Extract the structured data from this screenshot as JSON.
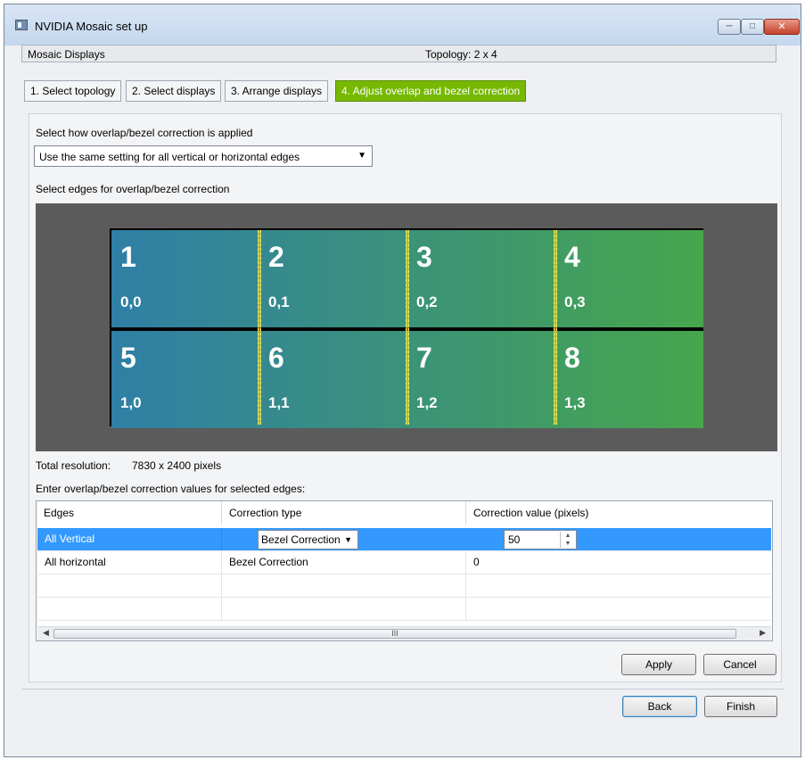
{
  "window": {
    "title": "NVIDIA Mosaic set up"
  },
  "header": {
    "left": "Mosaic Displays",
    "right": "Topology: 2 x 4"
  },
  "tabs": [
    {
      "label": "1. Select topology"
    },
    {
      "label": "2. Select displays"
    },
    {
      "label": "3. Arrange displays"
    },
    {
      "label": "4. Adjust overlap and bezel correction",
      "active": true
    }
  ],
  "apply_mode": {
    "label": "Select how overlap/bezel correction is applied",
    "selected": "Use the same setting for all vertical or horizontal edges"
  },
  "edges_label": "Select edges for overlap/bezel correction",
  "displays": [
    {
      "num": "1",
      "coord": "0,0"
    },
    {
      "num": "2",
      "coord": "0,1"
    },
    {
      "num": "3",
      "coord": "0,2"
    },
    {
      "num": "4",
      "coord": "0,3"
    },
    {
      "num": "5",
      "coord": "1,0"
    },
    {
      "num": "6",
      "coord": "1,1"
    },
    {
      "num": "7",
      "coord": "1,2"
    },
    {
      "num": "8",
      "coord": "1,3"
    }
  ],
  "resolution": {
    "label": "Total resolution:",
    "value": "7830 x 2400 pixels"
  },
  "values_label": "Enter overlap/bezel correction values for selected edges:",
  "table": {
    "columns": [
      "Edges",
      "Correction type",
      "Correction value (pixels)"
    ],
    "rows": [
      {
        "edge": "All Vertical",
        "type": "Bezel Correction",
        "value": "50"
      },
      {
        "edge": "All horizontal",
        "type": "Bezel Correction",
        "value": "0"
      }
    ],
    "scroll_thumb_glyph": "III"
  },
  "buttons": {
    "apply": "Apply",
    "cancel": "Cancel",
    "back": "Back",
    "finish": "Finish"
  },
  "colors": {
    "accent": "#76b900",
    "selection": "#3399ff",
    "tile_left": "#2f7fa6",
    "tile_right": "#46a64c"
  }
}
